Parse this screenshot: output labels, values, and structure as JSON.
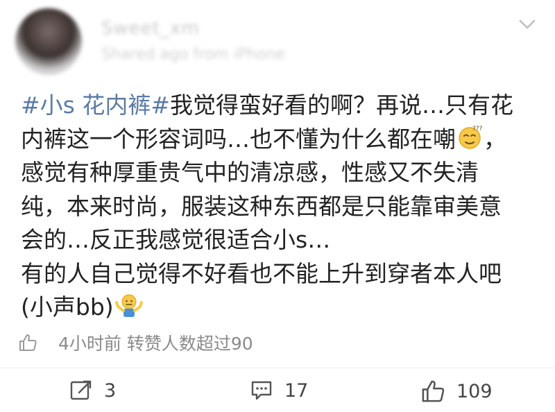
{
  "header": {
    "username": "Sweet_xm",
    "meta": "Shared ago from iPhone"
  },
  "post": {
    "hashtag": "#小s 花内裤#",
    "line1_text": "我觉得蛮好看的啊？再说…只有花",
    "line2_text": "内裤这一个形容词吗…也不懂为什么都在嘲",
    "line2_suffix": "，",
    "line3": "感觉有种厚重贵气中的清凉感，性感又不失清",
    "line4": "纯，本来时尚，服装这种东西都是只能靠审美意",
    "line5": "会的…反正我感觉很适合小s…",
    "line6": "有的人自己觉得不好看也不能上升到穿者本人吧",
    "line7_text": "(小声bb)"
  },
  "like_info": {
    "text": "4小时前 转赞人数超过90"
  },
  "actions": {
    "repost_count": "3",
    "comment_count": "17",
    "like_count": "109"
  },
  "icons": {
    "chevron": "chevron-down-icon",
    "thinking_emoji": "thinking-face-icon",
    "shrug_emoji": "shrug-icon",
    "thumb": "thumbs-up-icon",
    "repost": "repost-icon",
    "comment": "comment-icon"
  },
  "colors": {
    "hashtag": "#5b7aa6",
    "text": "#222222",
    "muted": "#8a8a8a"
  }
}
